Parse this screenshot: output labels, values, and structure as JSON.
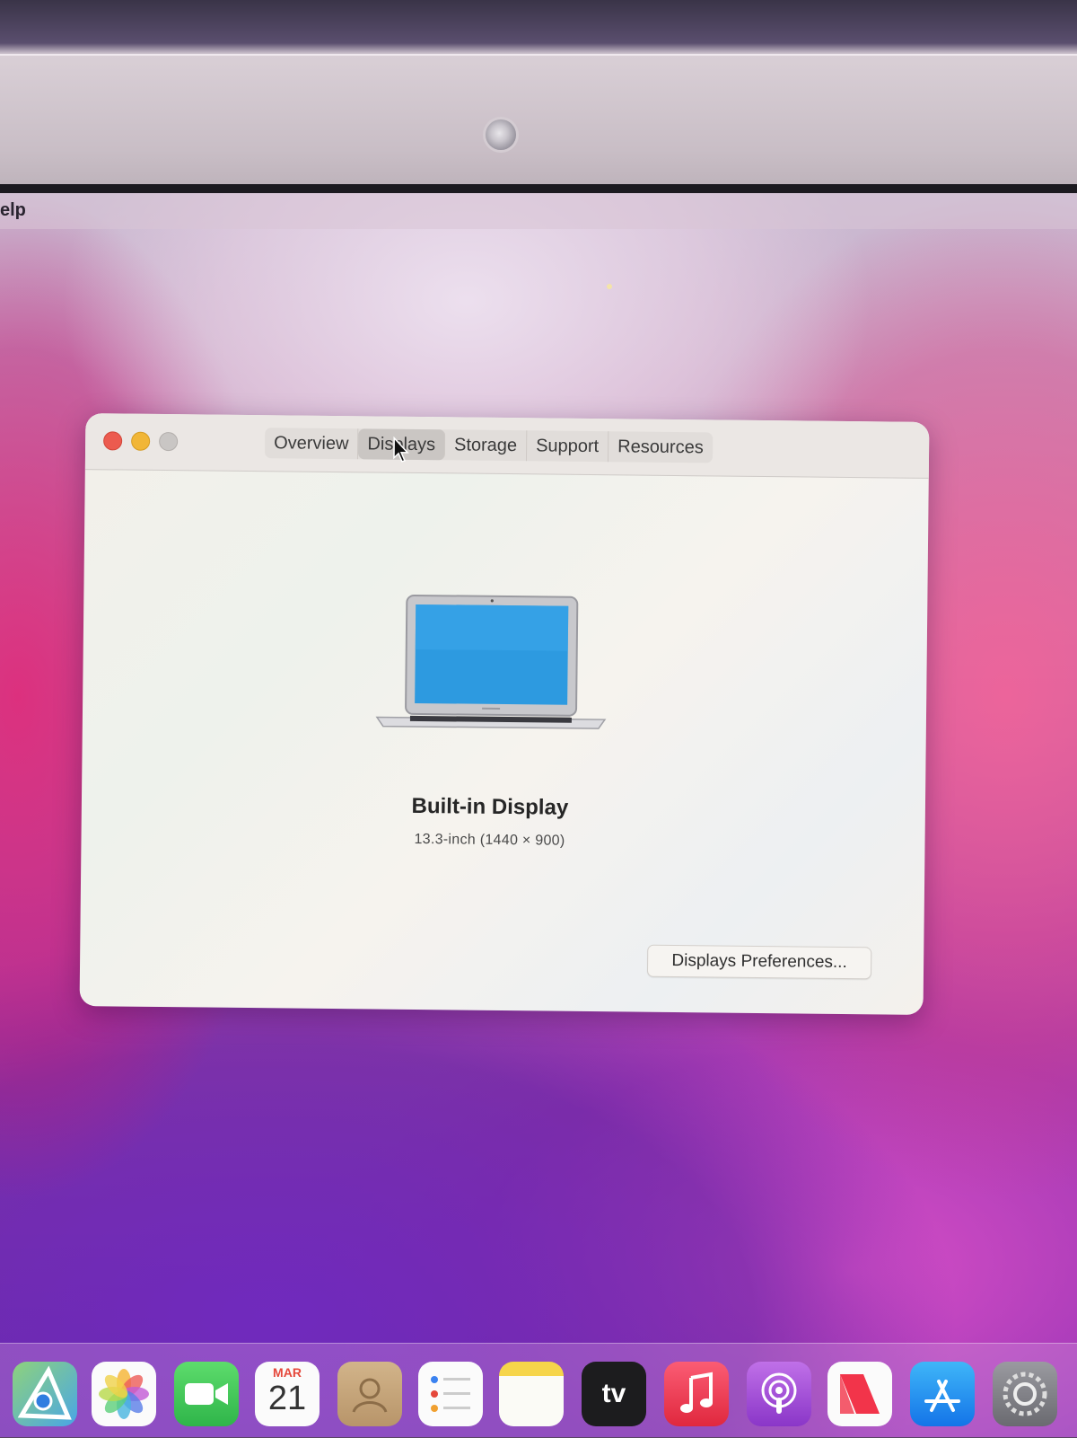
{
  "menubar": {
    "help_fragment": "elp"
  },
  "window": {
    "tabs": [
      {
        "label": "Overview",
        "active": false
      },
      {
        "label": "Displays",
        "active": true
      },
      {
        "label": "Storage",
        "active": false
      },
      {
        "label": "Support",
        "active": false
      },
      {
        "label": "Resources",
        "active": false
      }
    ],
    "display": {
      "name": "Built-in Display",
      "spec": "13.3-inch (1440 × 900)"
    },
    "preferences_button": "Displays Preferences..."
  },
  "dock": {
    "calendar": {
      "month": "MAR",
      "day": "21"
    },
    "tv_label": "tv",
    "icons": [
      "maps-icon",
      "photos-icon",
      "facetime-icon",
      "calendar-icon",
      "contacts-icon",
      "reminders-icon",
      "notes-icon",
      "apple-tv-icon",
      "music-icon",
      "podcasts-icon",
      "news-icon",
      "app-store-icon",
      "system-preferences-icon"
    ]
  },
  "colors": {
    "close": "#ec5b4f",
    "minimize": "#f1b637",
    "zoom_inactive": "#c9c6c4",
    "laptop_screen": "#2d9ae0"
  }
}
